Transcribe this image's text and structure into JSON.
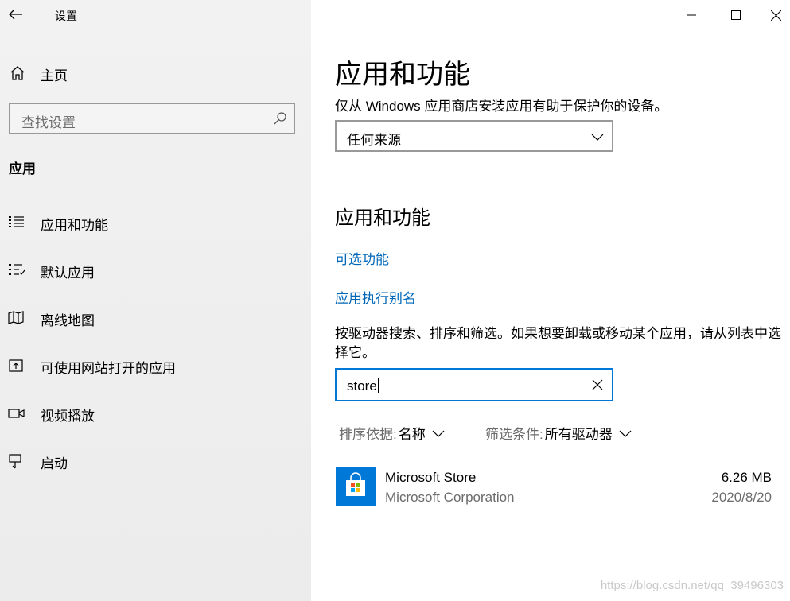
{
  "window": {
    "title": "设置",
    "controls": [
      "minimize",
      "maximize",
      "close"
    ]
  },
  "sidebar": {
    "home_label": "主页",
    "search_placeholder": "查找设置",
    "section_heading": "应用",
    "items": [
      {
        "label": "应用和功能",
        "icon": "apps-features-icon"
      },
      {
        "label": "默认应用",
        "icon": "default-apps-icon"
      },
      {
        "label": "离线地图",
        "icon": "map-icon"
      },
      {
        "label": "可使用网站打开的应用",
        "icon": "open-in-app-icon"
      },
      {
        "label": "视频播放",
        "icon": "video-icon"
      },
      {
        "label": "启动",
        "icon": "startup-icon"
      }
    ]
  },
  "main": {
    "title": "应用和功能",
    "install_source_desc": "仅从 Windows 应用商店安装应用有助于保护你的设备。",
    "install_source_value": "任何来源",
    "subheading": "应用和功能",
    "links": {
      "optional_features": "可选功能",
      "app_alias": "应用执行别名"
    },
    "filter_desc": "按驱动器搜索、排序和筛选。如果想要卸载或移动某个应用，请从列表中选择它。",
    "app_search_value": "store",
    "sort_label": "排序依据:",
    "sort_value": "名称",
    "filter_label": "筛选条件:",
    "filter_value": "所有驱动器",
    "apps": [
      {
        "name": "Microsoft Store",
        "publisher": "Microsoft Corporation",
        "size": "6.26 MB",
        "date": "2020/8/20"
      }
    ]
  },
  "watermark": "https://blog.csdn.net/qq_39496303",
  "colors": {
    "sidebar_bg": "#f2f2f2",
    "link": "#0067b8",
    "focus_border": "#0078d7",
    "store_icon_bg": "#0078d7"
  }
}
